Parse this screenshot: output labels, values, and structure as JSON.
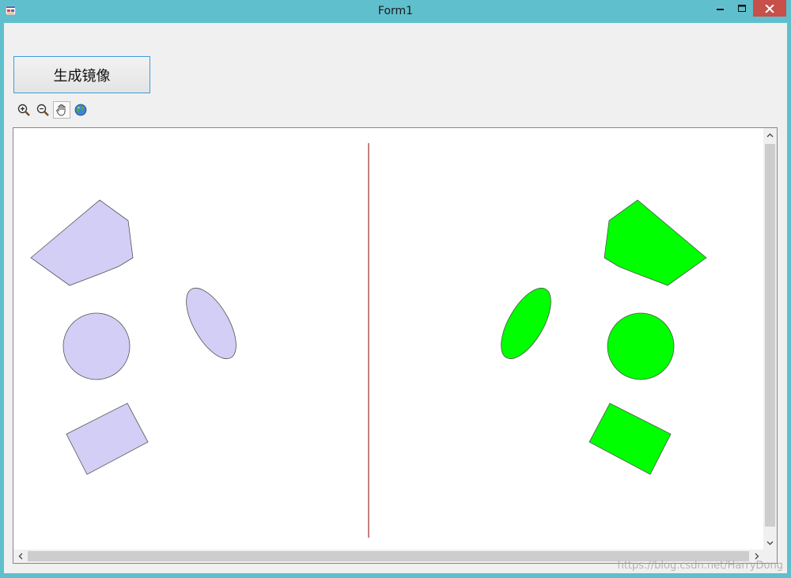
{
  "window": {
    "title": "Form1",
    "icons": {
      "app": "form-app-icon",
      "minimize": "minimize-icon",
      "maximize": "maximize-icon",
      "close": "close-icon"
    },
    "colors": {
      "frame": "#5fbfcd",
      "close_button": "#c7504b"
    }
  },
  "toolbar": {
    "mirror_button_label": "生成镜像",
    "tools": [
      {
        "name": "zoom-in",
        "icon": "zoom-in-icon"
      },
      {
        "name": "zoom-out",
        "icon": "zoom-out-icon"
      },
      {
        "name": "pan",
        "icon": "hand-pan-icon",
        "active": true
      },
      {
        "name": "full-extent",
        "icon": "globe-icon"
      }
    ]
  },
  "map": {
    "background": "#ffffff",
    "mirror_line_color": "#8b0000",
    "original_fill": "#d2cef5",
    "mirror_fill": "#00ff00",
    "outline": "#555555",
    "original_features": [
      {
        "type": "polygon",
        "name": "pentagon"
      },
      {
        "type": "ellipse",
        "name": "tilted-ellipse"
      },
      {
        "type": "circle",
        "name": "circle"
      },
      {
        "type": "polygon",
        "name": "rectangle"
      }
    ],
    "mirrored_features": [
      {
        "type": "polygon",
        "name": "pentagon"
      },
      {
        "type": "ellipse",
        "name": "tilted-ellipse"
      },
      {
        "type": "circle",
        "name": "circle"
      },
      {
        "type": "polygon",
        "name": "rectangle"
      }
    ]
  },
  "watermark": "https://blog.csdn.net/HarryDong"
}
